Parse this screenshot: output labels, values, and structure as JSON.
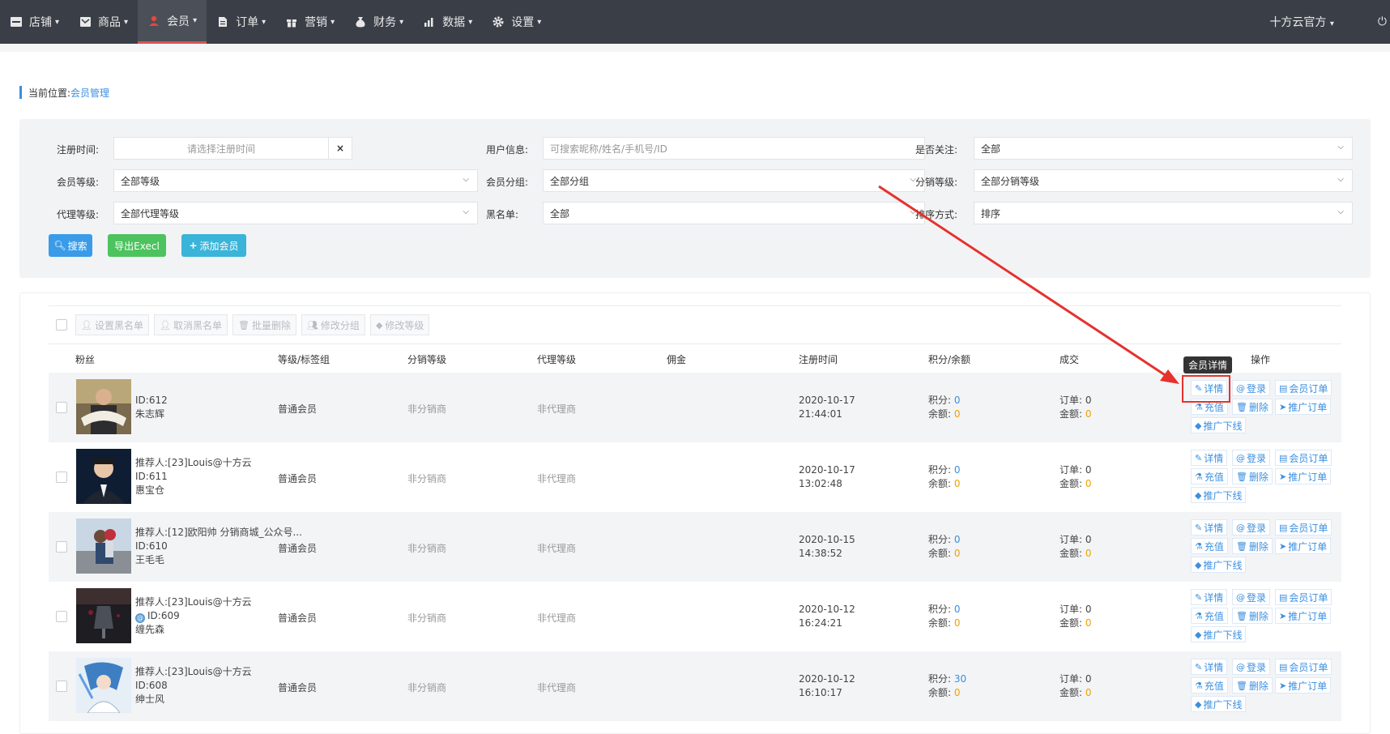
{
  "nav": {
    "items": [
      {
        "label": "店铺",
        "icon": "store-icon"
      },
      {
        "label": "商品",
        "icon": "goods-icon"
      },
      {
        "label": "会员",
        "icon": "member-icon",
        "active": true
      },
      {
        "label": "订单",
        "icon": "order-icon"
      },
      {
        "label": "营销",
        "icon": "gift-icon"
      },
      {
        "label": "财务",
        "icon": "money-bag-icon"
      },
      {
        "label": "数据",
        "icon": "bar-chart-icon"
      },
      {
        "label": "设置",
        "icon": "gear-icon"
      }
    ],
    "account": "十方云官方",
    "active_color": "#d9534f"
  },
  "breadcrumb": {
    "prefix": "当前位置:",
    "current": "会员管理"
  },
  "filters": {
    "reg_time_label": "注册时间:",
    "reg_time_placeholder": "请选择注册时间",
    "clear": "×",
    "user_info_label": "用户信息:",
    "user_info_placeholder": "可搜索昵称/姓名/手机号/ID",
    "follow_label": "是否关注:",
    "follow_value": "全部",
    "level_label": "会员等级:",
    "level_value": "全部等级",
    "group_label": "会员分组:",
    "group_value": "全部分组",
    "dist_label": "分销等级:",
    "dist_value": "全部分销等级",
    "agent_label": "代理等级:",
    "agent_value": "全部代理等级",
    "blacklist_label": "黑名单:",
    "blacklist_value": "全部",
    "sort_label": "排序方式:",
    "sort_value": "排序",
    "search_btn": "搜索",
    "export_btn": "导出Execl",
    "add_btn": "添加会员"
  },
  "toolbar": {
    "set_black": "设置黑名单",
    "cancel_black": "取消黑名单",
    "batch_delete": "批量删除",
    "edit_group": "修改分组",
    "edit_level": "修改等级"
  },
  "table": {
    "headers": {
      "fans": "粉丝",
      "level": "等级/标签组",
      "dist": "分销等级",
      "agent": "代理等级",
      "commission": "佣金",
      "reg": "注册时间",
      "points": "积分/余额",
      "deal": "成交",
      "ops": "操作"
    },
    "rows": [
      {
        "referrer": "",
        "id": "ID:612",
        "name": "朱志辉",
        "level": "普通会员",
        "dist": "非分销商",
        "agent": "非代理商",
        "date": "2020-10-17",
        "time": "21:44:01",
        "points_label": "积分:",
        "points": "0",
        "balance_label": "余额:",
        "balance": "0",
        "orders_label": "订单:",
        "orders": "0",
        "amount_label": "金额:",
        "amount": "0"
      },
      {
        "referrer": "推荐人:[23]Louis@十方云",
        "id": "ID:611",
        "name": "惠宝仓",
        "level": "普通会员",
        "dist": "非分销商",
        "agent": "非代理商",
        "date": "2020-10-17",
        "time": "13:02:48",
        "points_label": "积分:",
        "points": "0",
        "balance_label": "余额:",
        "balance": "0",
        "orders_label": "订单:",
        "orders": "0",
        "amount_label": "金额:",
        "amount": "0"
      },
      {
        "referrer": "推荐人:[12]欧阳帅 分销商城_公众号...",
        "id": "ID:610",
        "name": "王毛毛",
        "level": "普通会员",
        "dist": "非分销商",
        "agent": "非代理商",
        "date": "2020-10-15",
        "time": "14:38:52",
        "points_label": "积分:",
        "points": "0",
        "balance_label": "余额:",
        "balance": "0",
        "orders_label": "订单:",
        "orders": "0",
        "amount_label": "金额:",
        "amount": "0"
      },
      {
        "referrer": "推荐人:[23]Louis@十方云",
        "id": "ID:609",
        "name": "缠先森",
        "level": "普通会员",
        "dist": "非分销商",
        "agent": "非代理商",
        "date": "2020-10-12",
        "time": "16:24:21",
        "points_label": "积分:",
        "points": "0",
        "balance_label": "余额:",
        "balance": "0",
        "orders_label": "订单:",
        "orders": "0",
        "amount_label": "金额:",
        "amount": "0"
      },
      {
        "referrer": "推荐人:[23]Louis@十方云",
        "id": "ID:608",
        "name": "绅士风",
        "level": "普通会员",
        "dist": "非分销商",
        "agent": "非代理商",
        "date": "2020-10-12",
        "time": "16:10:17",
        "points_label": "积分:",
        "points": "30",
        "balance_label": "余额:",
        "balance": "0",
        "orders_label": "订单:",
        "orders": "0",
        "amount_label": "金额:",
        "amount": "0"
      }
    ],
    "actions": {
      "detail": "详情",
      "login": "登录",
      "member_orders": "会员订单",
      "recharge": "充值",
      "delete": "删除",
      "promo_orders": "推广订单",
      "promo_downline": "推广下线"
    },
    "tooltip": "会员详情"
  }
}
